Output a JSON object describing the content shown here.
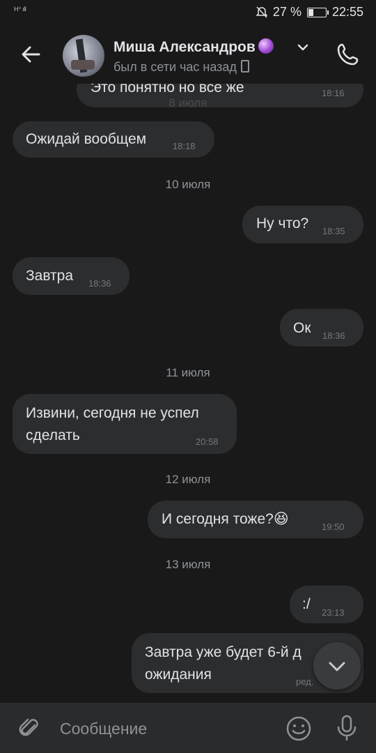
{
  "status_bar": {
    "signal_text": "H⁺ ıll",
    "battery_percent": "27 %",
    "time": "22:55",
    "battery_level": 0.27
  },
  "header": {
    "contact_name": "Миша Александров",
    "status": "был в сети час назад"
  },
  "messages": [
    {
      "type": "out",
      "text": "Это понятно но все же",
      "time": "18:16"
    },
    {
      "type": "date",
      "text": "8 июля"
    },
    {
      "type": "in",
      "text": "Ожидай вообщем",
      "time": "18:18"
    },
    {
      "type": "date",
      "text": "10 июля"
    },
    {
      "type": "out",
      "text": "Ну что?",
      "time": "18:35"
    },
    {
      "type": "in",
      "text": "Завтра",
      "time": "18:36"
    },
    {
      "type": "out",
      "text": "Ок",
      "time": "18:36"
    },
    {
      "type": "date",
      "text": "11 июля"
    },
    {
      "type": "in",
      "text_line1": "Извини, сегодня не успел",
      "text_line2": "сделать",
      "time": "20:58"
    },
    {
      "type": "date",
      "text": "12 июля"
    },
    {
      "type": "out",
      "text": "И сегодня тоже?",
      "emoji": "😆",
      "time": "19:50"
    },
    {
      "type": "date",
      "text": "13 июля"
    },
    {
      "type": "out",
      "text": ":/",
      "time": "23:13"
    },
    {
      "type": "out",
      "text_line1": "Завтра уже будет 6-й д",
      "text_line2": "ожидания",
      "edited": "ред."
    }
  ],
  "composer": {
    "placeholder": "Сообщение"
  },
  "colors": {
    "background": "#19191a",
    "bubble": "#2c2d2e",
    "composer": "#2a2b2c",
    "text": "#e1e3e6",
    "muted": "#76787a"
  }
}
